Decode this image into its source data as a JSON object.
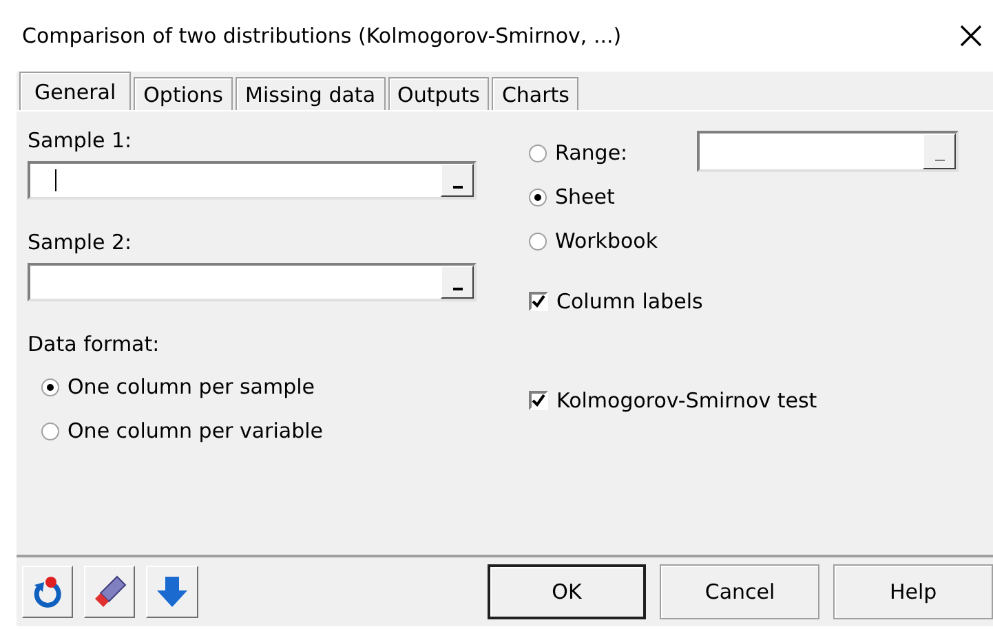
{
  "window": {
    "title": "Comparison of two distributions (Kolmogorov-Smirnov, ...)"
  },
  "tabs": [
    {
      "label": "General",
      "selected": true
    },
    {
      "label": "Options",
      "selected": false
    },
    {
      "label": "Missing data",
      "selected": false
    },
    {
      "label": "Outputs",
      "selected": false
    },
    {
      "label": "Charts",
      "selected": false
    }
  ],
  "samples": [
    {
      "label": "Sample 1:",
      "focused": true
    },
    {
      "label": "Sample 2:",
      "focused": false
    }
  ],
  "data_format": {
    "label": "Data format:",
    "options": [
      {
        "label": "One column per sample",
        "selected": true
      },
      {
        "label": "One column per variable",
        "selected": false
      }
    ]
  },
  "output_target": [
    {
      "label": "Range:",
      "selected": false,
      "kind": "with_field"
    },
    {
      "label": "Sheet",
      "selected": true,
      "kind": "plain"
    },
    {
      "label": "Workbook",
      "selected": false,
      "kind": "plain"
    }
  ],
  "column_labels": {
    "label": "Column labels",
    "checked": true
  },
  "ks_test": {
    "label": "Kolmogorov-Smirnov test",
    "checked": true
  },
  "buttons": [
    {
      "label": "OK",
      "default": true
    },
    {
      "label": "Cancel",
      "default": false
    },
    {
      "label": "Help",
      "default": false
    }
  ]
}
